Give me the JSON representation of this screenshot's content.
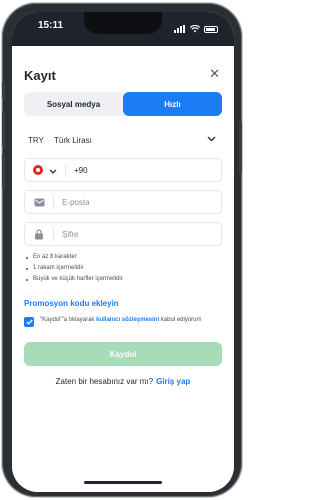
{
  "status": {
    "time": "15:11"
  },
  "header": {
    "title": "Kayıt",
    "close_label": "✕"
  },
  "tabs": [
    {
      "label": "Sosyal medya",
      "active": false
    },
    {
      "label": "Hızlı",
      "active": true
    }
  ],
  "currency": {
    "code": "TRY",
    "name": "Türk Lirası"
  },
  "phone": {
    "country_prefix": "+90"
  },
  "email": {
    "placeholder": "E-posta"
  },
  "password": {
    "placeholder": "Şifre",
    "rules": [
      "En az 8 karakter",
      "1 rakam içermelidir",
      "Büyük ve küçük harfler içermelidir"
    ]
  },
  "promo": {
    "label": "Promosyon kodu ekleyin"
  },
  "agreement": {
    "text_before": "\"Kaydol\"'a tıklayarak ",
    "link": "kullanıcı sözleşmesini",
    "text_after": " kabul ediyorum",
    "checked": true
  },
  "submit": {
    "label": "Kaydol"
  },
  "login": {
    "prompt": "Zaten bir hesabınız var mı?",
    "link": "Giriş yap"
  },
  "colors": {
    "accent": "#1a7cf5",
    "submit_disabled": "#a6dcb7"
  }
}
